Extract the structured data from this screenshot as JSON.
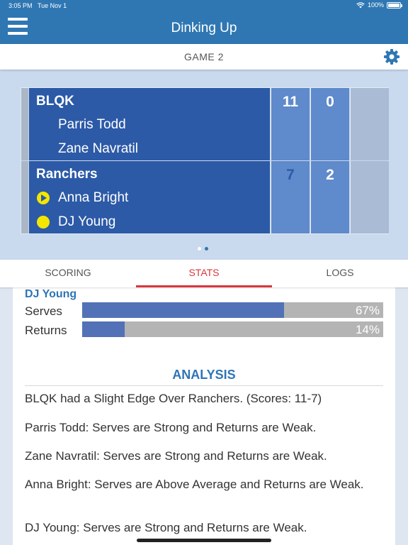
{
  "status_bar": {
    "time": "3:05 PM",
    "date": "Tue Nov 1",
    "battery": "100%"
  },
  "nav": {
    "title": "Dinking Up",
    "icons": {
      "menu": "hamburger-menu-icon",
      "wifi": "wifi-icon",
      "battery": "battery-icon"
    }
  },
  "game": {
    "label": "GAME 2",
    "settings_icon": "gear-icon"
  },
  "scoreboard": {
    "teams": [
      {
        "name": "BLQK",
        "players": [
          "Parris Todd",
          "Zane Navratil"
        ],
        "scores": [
          "11",
          "0",
          ""
        ]
      },
      {
        "name": "Ranchers",
        "players": [
          "Anna Bright",
          "DJ Young"
        ],
        "scores": [
          "7",
          "2",
          ""
        ]
      }
    ],
    "server_icons": [
      "serve-play-icon",
      "serve-ball-icon"
    ]
  },
  "pager": {
    "pages": 2,
    "active": 2
  },
  "tabs": {
    "scoring": "SCORING",
    "stats": "STATS",
    "logs": "LOGS",
    "active": "STATS"
  },
  "stats": {
    "player": "DJ Young",
    "rows": [
      {
        "label": "Serves",
        "value": "67%",
        "fraction": 0.67
      },
      {
        "label": "Returns",
        "value": "14%",
        "fraction": 0.14
      }
    ]
  },
  "analysis": {
    "title": "ANALYSIS",
    "lines": [
      "BLQK had a Slight Edge Over Ranchers. (Scores: 11-7)",
      "Parris Todd: Serves are Strong and Returns are Weak.",
      "Zane Navratil: Serves are Strong and Returns are Weak.",
      "Anna Bright: Serves are Above Average and Returns are Weak.",
      "DJ Young: Serves are Strong and Returns are Weak."
    ]
  },
  "colors": {
    "primary": "#2f77b3",
    "team_panel": "#2c5aa7",
    "score_cell": "#5f8acb",
    "accent_red": "#d9373c",
    "serve_yellow": "#f3e600",
    "bar_fill": "#5271b7",
    "bar_track": "#b4b4b4"
  }
}
